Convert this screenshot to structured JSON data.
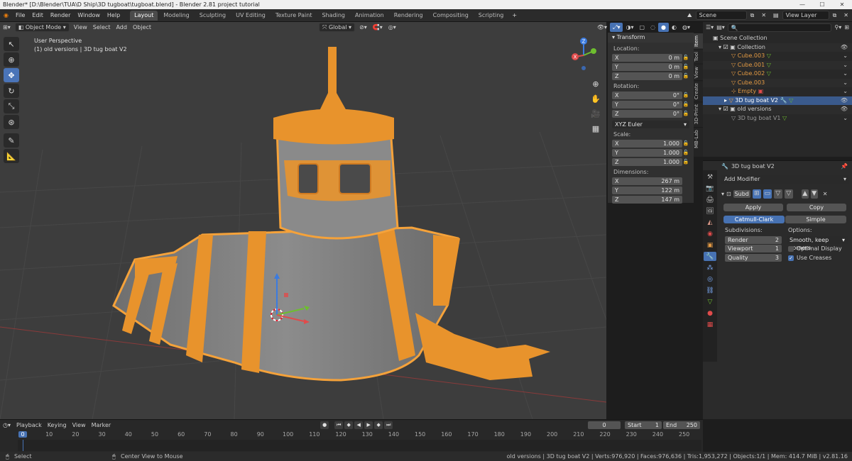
{
  "window": {
    "title": "Blender* [D:\\Blender\\TUA\\D Ship\\3D tugboat\\tugboat.blend] - Blender 2.81 project tutorial",
    "controls": [
      "—",
      "☐",
      "✕"
    ]
  },
  "menu": [
    "File",
    "Edit",
    "Render",
    "Window",
    "Help"
  ],
  "workspaces": [
    "Layout",
    "Modeling",
    "Sculpting",
    "UV Editing",
    "Texture Paint",
    "Shading",
    "Animation",
    "Rendering",
    "Compositing",
    "Scripting"
  ],
  "active_workspace": "Layout",
  "scene": "Scene",
  "view_layer": "View Layer",
  "viewport": {
    "mode": "Object Mode",
    "menus": [
      "View",
      "Select",
      "Add",
      "Object"
    ],
    "transform_orientation": "Global",
    "overlay_title": "User Perspective",
    "overlay_subtitle": "(1) old versions | 3D tug boat V2",
    "gizmo_labels": {
      "x": "X",
      "y": "Y",
      "z": "Z"
    }
  },
  "npanel": {
    "section": "Transform",
    "location_label": "Location:",
    "location": [
      {
        "axis": "X",
        "value": "0 m"
      },
      {
        "axis": "Y",
        "value": "0 m"
      },
      {
        "axis": "Z",
        "value": "0 m"
      }
    ],
    "rotation_label": "Rotation:",
    "rotation": [
      {
        "axis": "X",
        "value": "0°"
      },
      {
        "axis": "Y",
        "value": "0°"
      },
      {
        "axis": "Z",
        "value": "0°"
      }
    ],
    "rotation_mode": "XYZ Euler",
    "scale_label": "Scale:",
    "scale": [
      {
        "axis": "X",
        "value": "1.000"
      },
      {
        "axis": "Y",
        "value": "1.000"
      },
      {
        "axis": "Z",
        "value": "1.000"
      }
    ],
    "dimensions_label": "Dimensions:",
    "dimensions": [
      {
        "axis": "X",
        "value": "267 m"
      },
      {
        "axis": "Y",
        "value": "122 m"
      },
      {
        "axis": "Z",
        "value": "147 m"
      }
    ],
    "tabs": [
      "Item",
      "Tool",
      "View",
      "Create",
      "3D-Print",
      "MB-Lab"
    ]
  },
  "outliner": {
    "search_placeholder": "",
    "rows": [
      {
        "label": "Scene Collection",
        "depth": 0
      },
      {
        "label": "Collection",
        "depth": 1
      },
      {
        "label": "Cube.003",
        "depth": 2
      },
      {
        "label": "Cube.001",
        "depth": 2
      },
      {
        "label": "Cube.002",
        "depth": 2
      },
      {
        "label": "Cube.003",
        "depth": 2
      },
      {
        "label": "Empty",
        "depth": 2
      },
      {
        "label": "3D tug boat V2",
        "depth": 2,
        "selected": true
      },
      {
        "label": "old versions",
        "depth": 1
      },
      {
        "label": "3D tug boat V1",
        "depth": 2
      }
    ]
  },
  "properties": {
    "object_name": "3D tug boat V2",
    "add_modifier": "Add Modifier",
    "modifier_name": "Subd",
    "apply": "Apply",
    "copy": "Copy",
    "algo_a": "Catmull-Clark",
    "algo_b": "Simple",
    "subdivisions_label": "Subdivisions:",
    "render_label": "Render",
    "render_value": "2",
    "viewport_label": "Viewport",
    "viewport_value": "1",
    "quality_label": "Quality",
    "quality_value": "3",
    "options_label": "Options:",
    "uv_smooth": "Smooth, keep corners",
    "optimal_display": "Optimal Display",
    "optimal_display_checked": false,
    "use_creases": "Use Creases",
    "use_creases_checked": true
  },
  "timeline": {
    "menus": [
      "Playback",
      "Keying",
      "View",
      "Marker"
    ],
    "current_frame": "0",
    "start_label": "Start",
    "start": "1",
    "end_label": "End",
    "end": "250",
    "ticks": [
      "0",
      "10",
      "20",
      "30",
      "40",
      "50",
      "60",
      "70",
      "80",
      "90",
      "100",
      "110",
      "120",
      "130",
      "140",
      "150",
      "160",
      "170",
      "180",
      "190",
      "200",
      "210",
      "220",
      "230",
      "240",
      "250"
    ]
  },
  "status": {
    "left": "Select",
    "middle": "Center View to Mouse",
    "right": "old versions | 3D tug boat V2 | Verts:976,920 | Faces:976,636 | Tris:1,953,272 | Objects:1/1 | Mem: 414.7 MiB | v2.81.16"
  },
  "colors": {
    "accent": "#4772b3",
    "selection_orange": "#f5a23a",
    "viewport_bg": "#3d3d3d"
  }
}
